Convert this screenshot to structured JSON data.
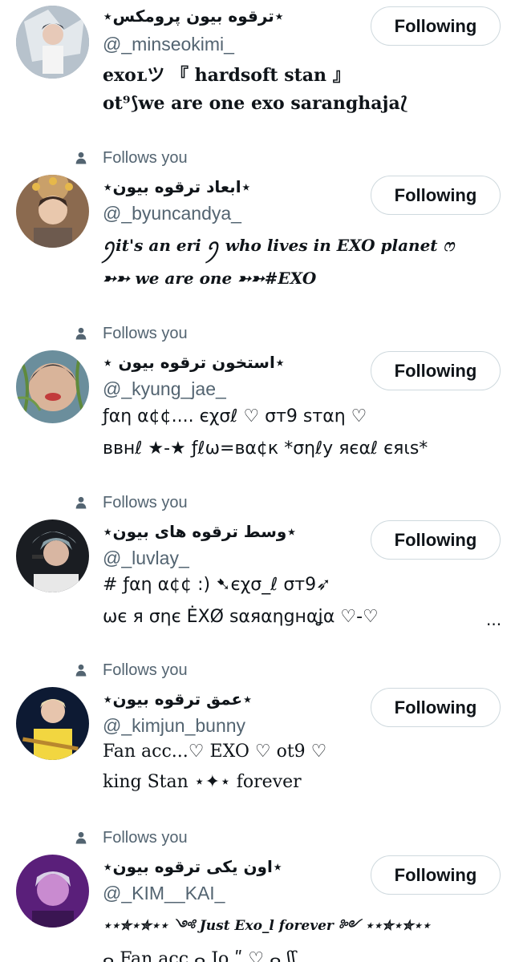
{
  "icons": {
    "follows_you": "person-icon"
  },
  "colors": {
    "secondary_text": "#536471",
    "primary_text": "#0f1419",
    "button_border": "#cfd9de"
  },
  "users": [
    {
      "follows_you": "",
      "name": "⋆ترقوه بیون پرومکس⋆",
      "handle": "@_minseokimi_",
      "bio_lines": [
        "exoʟツ 『 hardsoft stan 』",
        "ot⁹⟆we are one exo saranghaja⟅"
      ],
      "button": "Following"
    },
    {
      "follows_you": "Follows you",
      "name": "⋆ابعاد ترقوه بیون⋆",
      "handle": "@_byuncandya_",
      "bio_lines": [
        "ꪆit's an eri ꪆ who lives in EXO planet ෆ",
        "➳➳ we are one ➳➳#EXO"
      ],
      "button": "Following"
    },
    {
      "follows_you": "Follows you",
      "name": "⋆استخون ترقوه بیون ⋆",
      "handle": "@_kyung_jae_",
      "bio_lines": [
        "ƒαη α¢¢.... єχσℓ ♡ σт9 ѕтαη ♡",
        "ввнℓ ★-★ ƒℓω=вα¢к *σηℓу яєαℓ єяιѕ*"
      ],
      "button": "Following"
    },
    {
      "follows_you": "Follows you",
      "name": "⋆وسط ترقوه های بیون⋆",
      "handle": "@_luvlay_",
      "bio_lines": [
        "# ƒαη α¢¢ :)  ➷єχσ_ℓ σт9➶",
        "ωє я σηє ĖXØ ѕαяαηgнαʝα ♡-♡"
      ],
      "ellipsis": "...",
      "button": "Following"
    },
    {
      "follows_you": "Follows you",
      "name": "⋆عمق ترقوه بیون⋆",
      "handle": "@_kimjun_bunny",
      "bio_lines": [
        "Fan acc...♡ EXO ♡ ot9 ♡",
        "king Stan ⋆✦⋆  forever"
      ],
      "button": "Following"
    },
    {
      "follows_you": "Follows you",
      "name": "⋆اون یکی ترقوه بیون⋆",
      "handle": "@_KIM__KAI_",
      "bio_lines": [
        "⋆⋆✮⋆✮⋆⋆ ༺ Just Exo_l forever ༻ ⋆⋆✮⋆✮⋆⋆"
      ],
      "button": "Following"
    }
  ],
  "partial_line": "ⴰ Fan acc  ⴰ  Jo ʺ ♡ ⴰ ʃʃ"
}
